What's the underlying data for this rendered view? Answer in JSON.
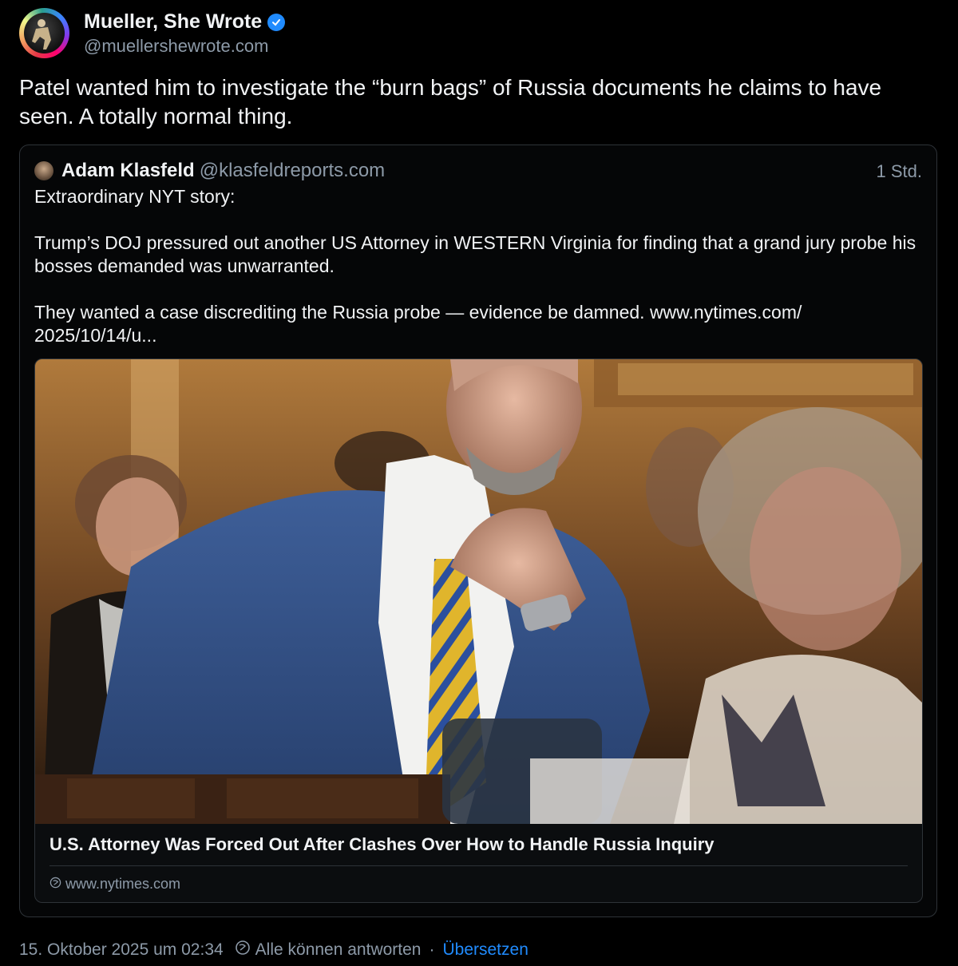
{
  "post": {
    "author_name": "Mueller, She Wrote",
    "handle": "@muellershewrote.com",
    "text": "Patel wanted him to investigate the “burn bags” of Russia documents he claims to have seen. A totally normal thing."
  },
  "quote": {
    "author_name": "Adam Klasfeld",
    "handle": "@klasfeldreports.com",
    "time": "1 Std.",
    "lines": [
      "Extraordinary NYT story:",
      "Trump’s DOJ pressured out another US Attorney in WESTERN Virginia for finding that a grand jury probe his bosses demanded was unwarranted.",
      "They wanted a case discrediting the Russia probe — evidence be damned. www.nytimes.com/ 2025/10/14/u..."
    ],
    "link_card": {
      "title": "U.S. Attorney Was Forced Out After Clashes Over How to Handle Russia Inquiry",
      "domain": "www.nytimes.com"
    }
  },
  "footer": {
    "timestamp": "15. Oktober 2025 um 02:34",
    "reply_setting": "Alle können antworten",
    "separator": "·",
    "translate": "Übersetzen"
  },
  "colors": {
    "background": "#000000",
    "text": "#f1f3f5",
    "muted": "#8d9aa8",
    "accent": "#208bfe",
    "border": "#2e3338"
  },
  "icons": [
    "verified-badge-icon",
    "globe-icon",
    "reply-settings-icon"
  ]
}
